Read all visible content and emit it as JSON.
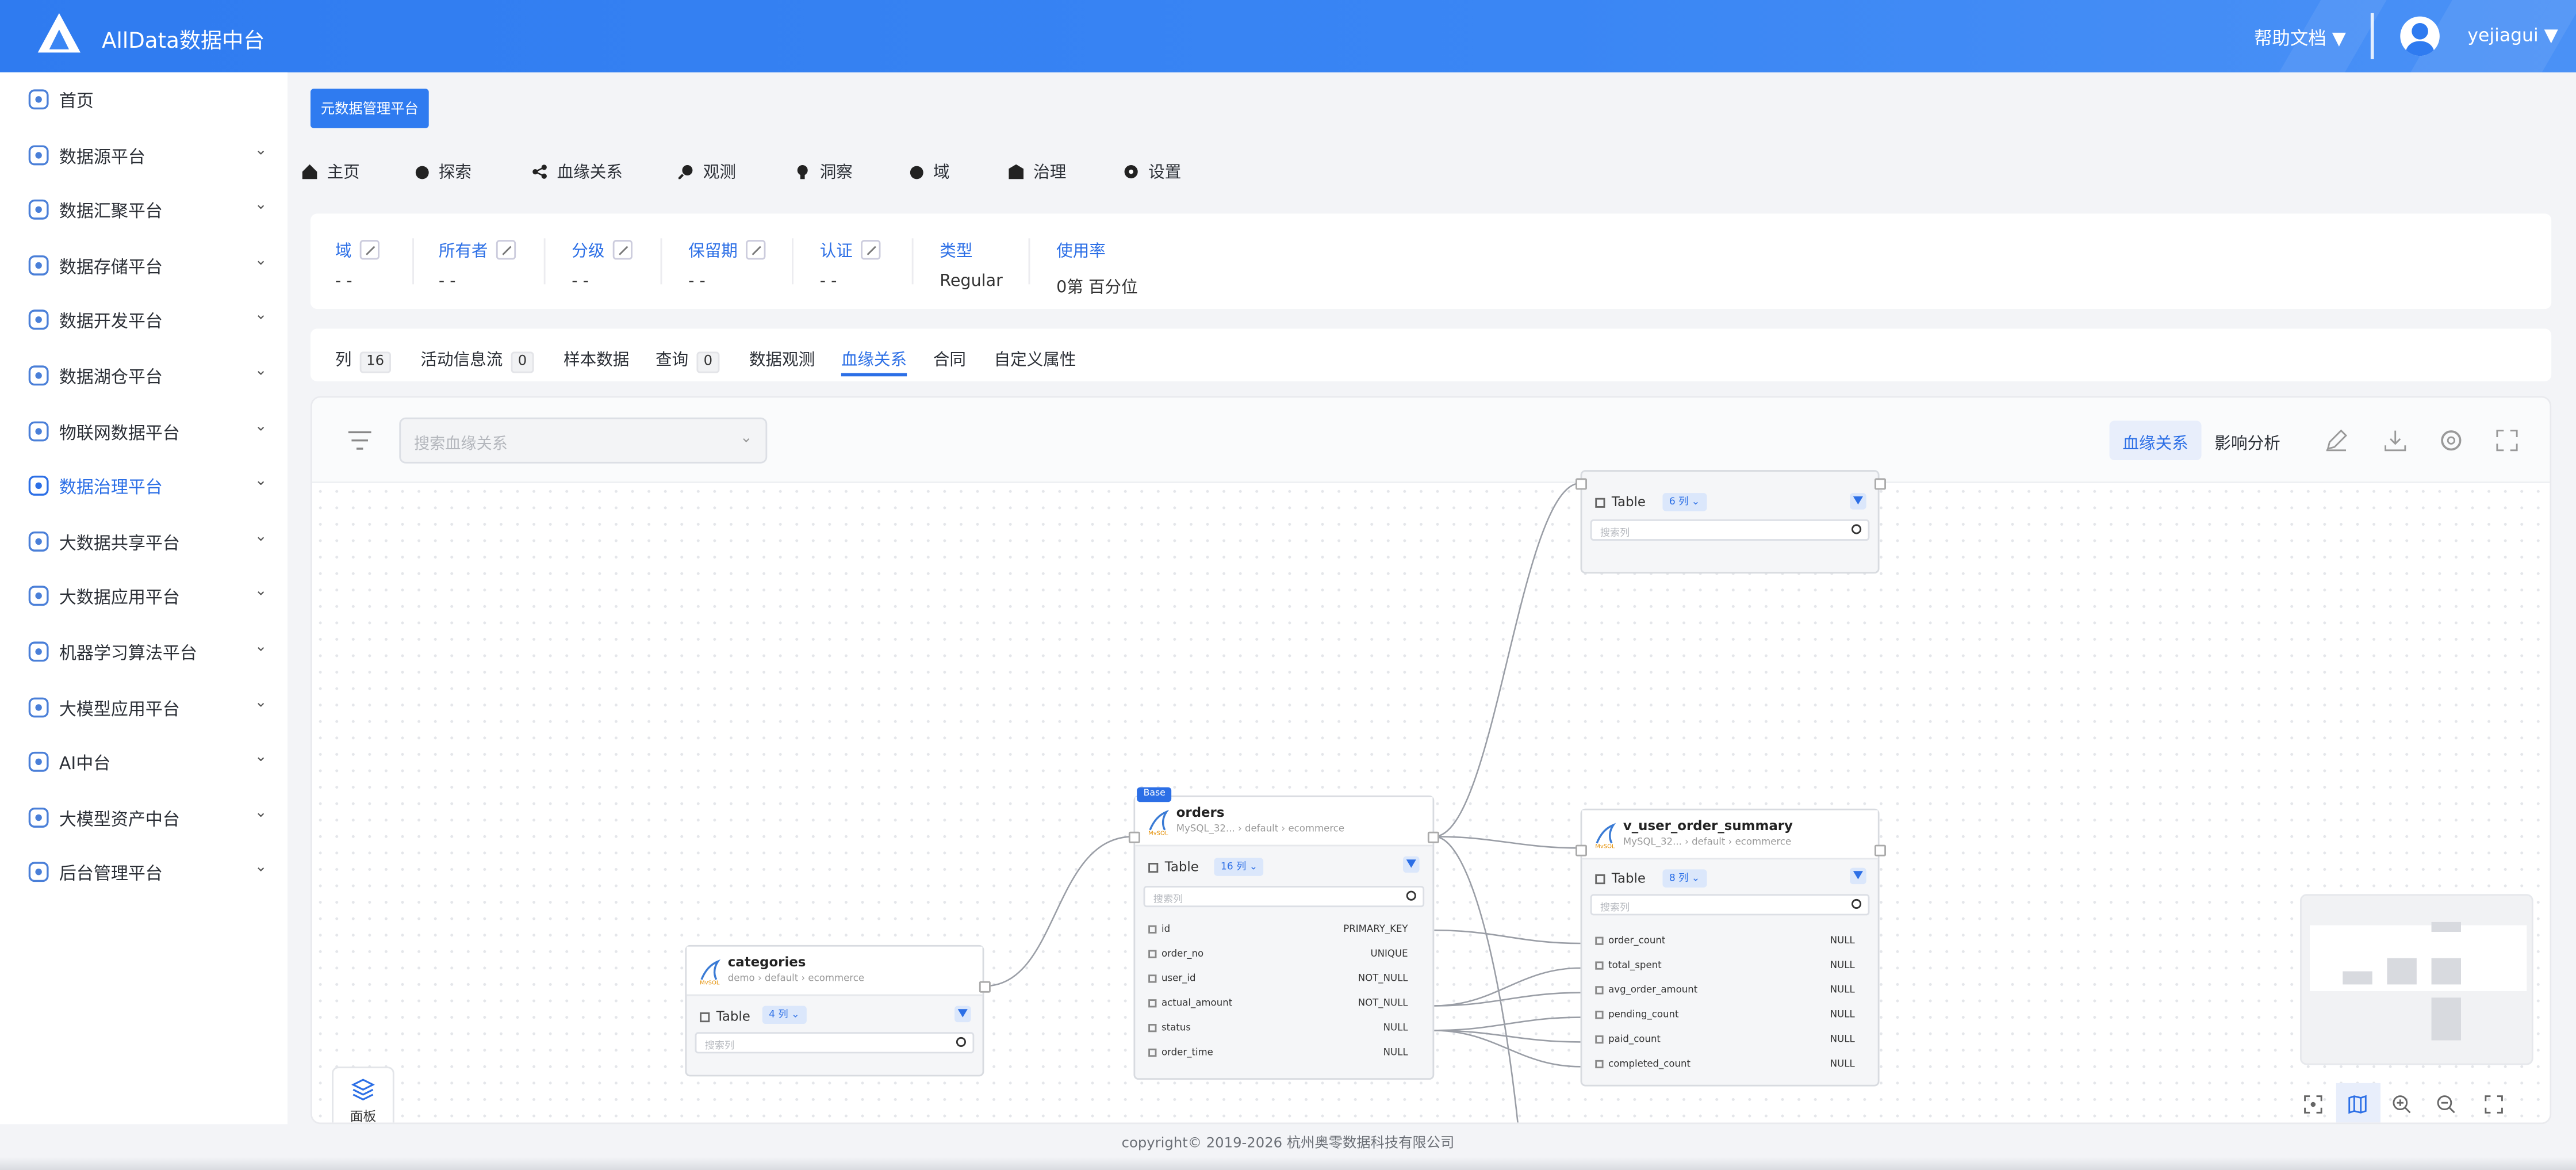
{
  "header": {
    "brand": "AllData数据中台",
    "help": "帮助文档 ▼",
    "user": "yejiagui ▼"
  },
  "sidebar": {
    "items": [
      {
        "label": "首页",
        "chevron": "",
        "icon": "home-icon"
      },
      {
        "label": "数据源平台",
        "chevron": "⌄",
        "icon": "database-icon"
      },
      {
        "label": "数据汇聚平台",
        "chevron": "⌄",
        "icon": "layers-icon"
      },
      {
        "label": "数据存储平台",
        "chevron": "⌄",
        "icon": "chart-icon"
      },
      {
        "label": "数据开发平台",
        "chevron": "⌄",
        "icon": "grid-icon"
      },
      {
        "label": "数据湖仓平台",
        "chevron": "⌄",
        "icon": "lake-icon"
      },
      {
        "label": "物联网数据平台",
        "chevron": "⌄",
        "icon": "iot-icon"
      },
      {
        "label": "数据治理平台",
        "chevron": "⌄",
        "icon": "governance-icon"
      },
      {
        "label": "大数据共享平台",
        "chevron": "⌄",
        "icon": "share-icon"
      },
      {
        "label": "大数据应用平台",
        "chevron": "⌄",
        "icon": "cube-icon"
      },
      {
        "label": "机器学习算法平台",
        "chevron": "⌄",
        "icon": "ml-icon"
      },
      {
        "label": "大模型应用平台",
        "chevron": "⌄",
        "icon": "network-icon"
      },
      {
        "label": "AI中台",
        "chevron": "⌄",
        "icon": "ai-icon"
      },
      {
        "label": "大模型资产中台",
        "chevron": "⌄",
        "icon": "network-icon"
      },
      {
        "label": "后台管理平台",
        "chevron": "⌄",
        "icon": "settings-icon"
      }
    ]
  },
  "main": {
    "meta_button": "元数据管理平台",
    "nav": [
      "主页",
      "探索",
      "血缘关系",
      "观测",
      "洞察",
      "域",
      "治理",
      "设置"
    ],
    "info": [
      {
        "key": "域",
        "value": "- -"
      },
      {
        "key": "所有者",
        "value": "- -"
      },
      {
        "key": "分级",
        "value": "- -"
      },
      {
        "key": "保留期",
        "value": "- -"
      },
      {
        "key": "认证",
        "value": "- -"
      },
      {
        "key": "类型",
        "value": "Regular"
      },
      {
        "key": "使用率",
        "value": "0第 百分位"
      }
    ],
    "tabs": [
      {
        "label": "列",
        "count": "16"
      },
      {
        "label": "活动信息流",
        "count": "0"
      },
      {
        "label": "样本数据",
        "count": ""
      },
      {
        "label": "查询",
        "count": "0"
      },
      {
        "label": "数据观测",
        "count": ""
      },
      {
        "label": "血缘关系",
        "count": ""
      },
      {
        "label": "合同",
        "count": ""
      },
      {
        "label": "自定义属性",
        "count": ""
      }
    ],
    "active_tab": "血缘关系"
  },
  "lineage": {
    "search_placeholder": "搜索血缘关系",
    "seg_lineage": "血缘关系",
    "seg_impact": "影响分析",
    "panel_label": "面板",
    "search_col": "搜索列",
    "table_label": "Table",
    "nodes": {
      "top": {
        "count": "6 列 ⌄"
      },
      "categories": {
        "title": "categories",
        "source": "demo",
        "db": "default",
        "schema": "ecommerce",
        "count": "4 列 ⌄"
      },
      "orders": {
        "badge": "Base",
        "title": "orders",
        "source": "MySQL_32...",
        "db": "default",
        "schema": "ecommerce",
        "count": "16 列 ⌄",
        "columns": [
          {
            "name": "id",
            "constraint": "PRIMARY_KEY"
          },
          {
            "name": "order_no",
            "constraint": "UNIQUE"
          },
          {
            "name": "user_id",
            "constraint": "NOT_NULL"
          },
          {
            "name": "actual_amount",
            "constraint": "NOT_NULL"
          },
          {
            "name": "status",
            "constraint": "NULL"
          },
          {
            "name": "order_time",
            "constraint": "NULL"
          }
        ]
      },
      "summary": {
        "title": "v_user_order_summary",
        "source": "MySQL_32...",
        "db": "default",
        "schema": "ecommerce",
        "count": "8 列 ⌄",
        "columns": [
          {
            "name": "order_count",
            "constraint": "NULL"
          },
          {
            "name": "total_spent",
            "constraint": "NULL"
          },
          {
            "name": "avg_order_amount",
            "constraint": "NULL"
          },
          {
            "name": "pending_count",
            "constraint": "NULL"
          },
          {
            "name": "paid_count",
            "constraint": "NULL"
          },
          {
            "name": "completed_count",
            "constraint": "NULL"
          }
        ]
      }
    }
  },
  "footer": "copyright© 2019-2026 杭州奥零数据科技有限公司",
  "colors": {
    "primary": "#2f7bf0",
    "accent_text": "#2c6fe6"
  }
}
